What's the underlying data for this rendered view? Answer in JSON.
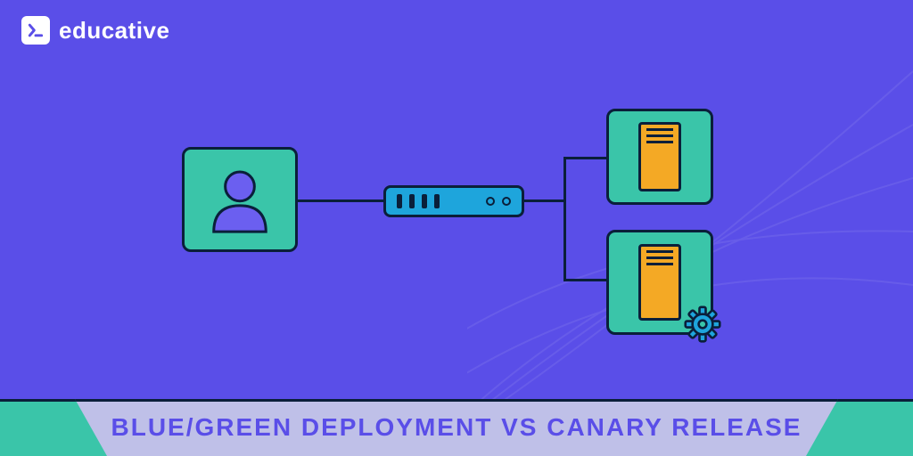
{
  "brand": {
    "name": "educative"
  },
  "banner": {
    "title": "BLUE/GREEN DEPLOYMENT VS CANARY RELEASE"
  },
  "colors": {
    "background": "#5a4ee8",
    "node": "#3ac5a9",
    "stroke": "#0a1f3a",
    "switch": "#1ea5dc",
    "server": "#f4a925",
    "banner_panel": "#bfc0e8",
    "accent": "#6b5ff0"
  },
  "icons": {
    "user": "user-icon",
    "switch": "network-switch-icon",
    "server": "server-tower-icon",
    "gear": "gear-icon"
  }
}
